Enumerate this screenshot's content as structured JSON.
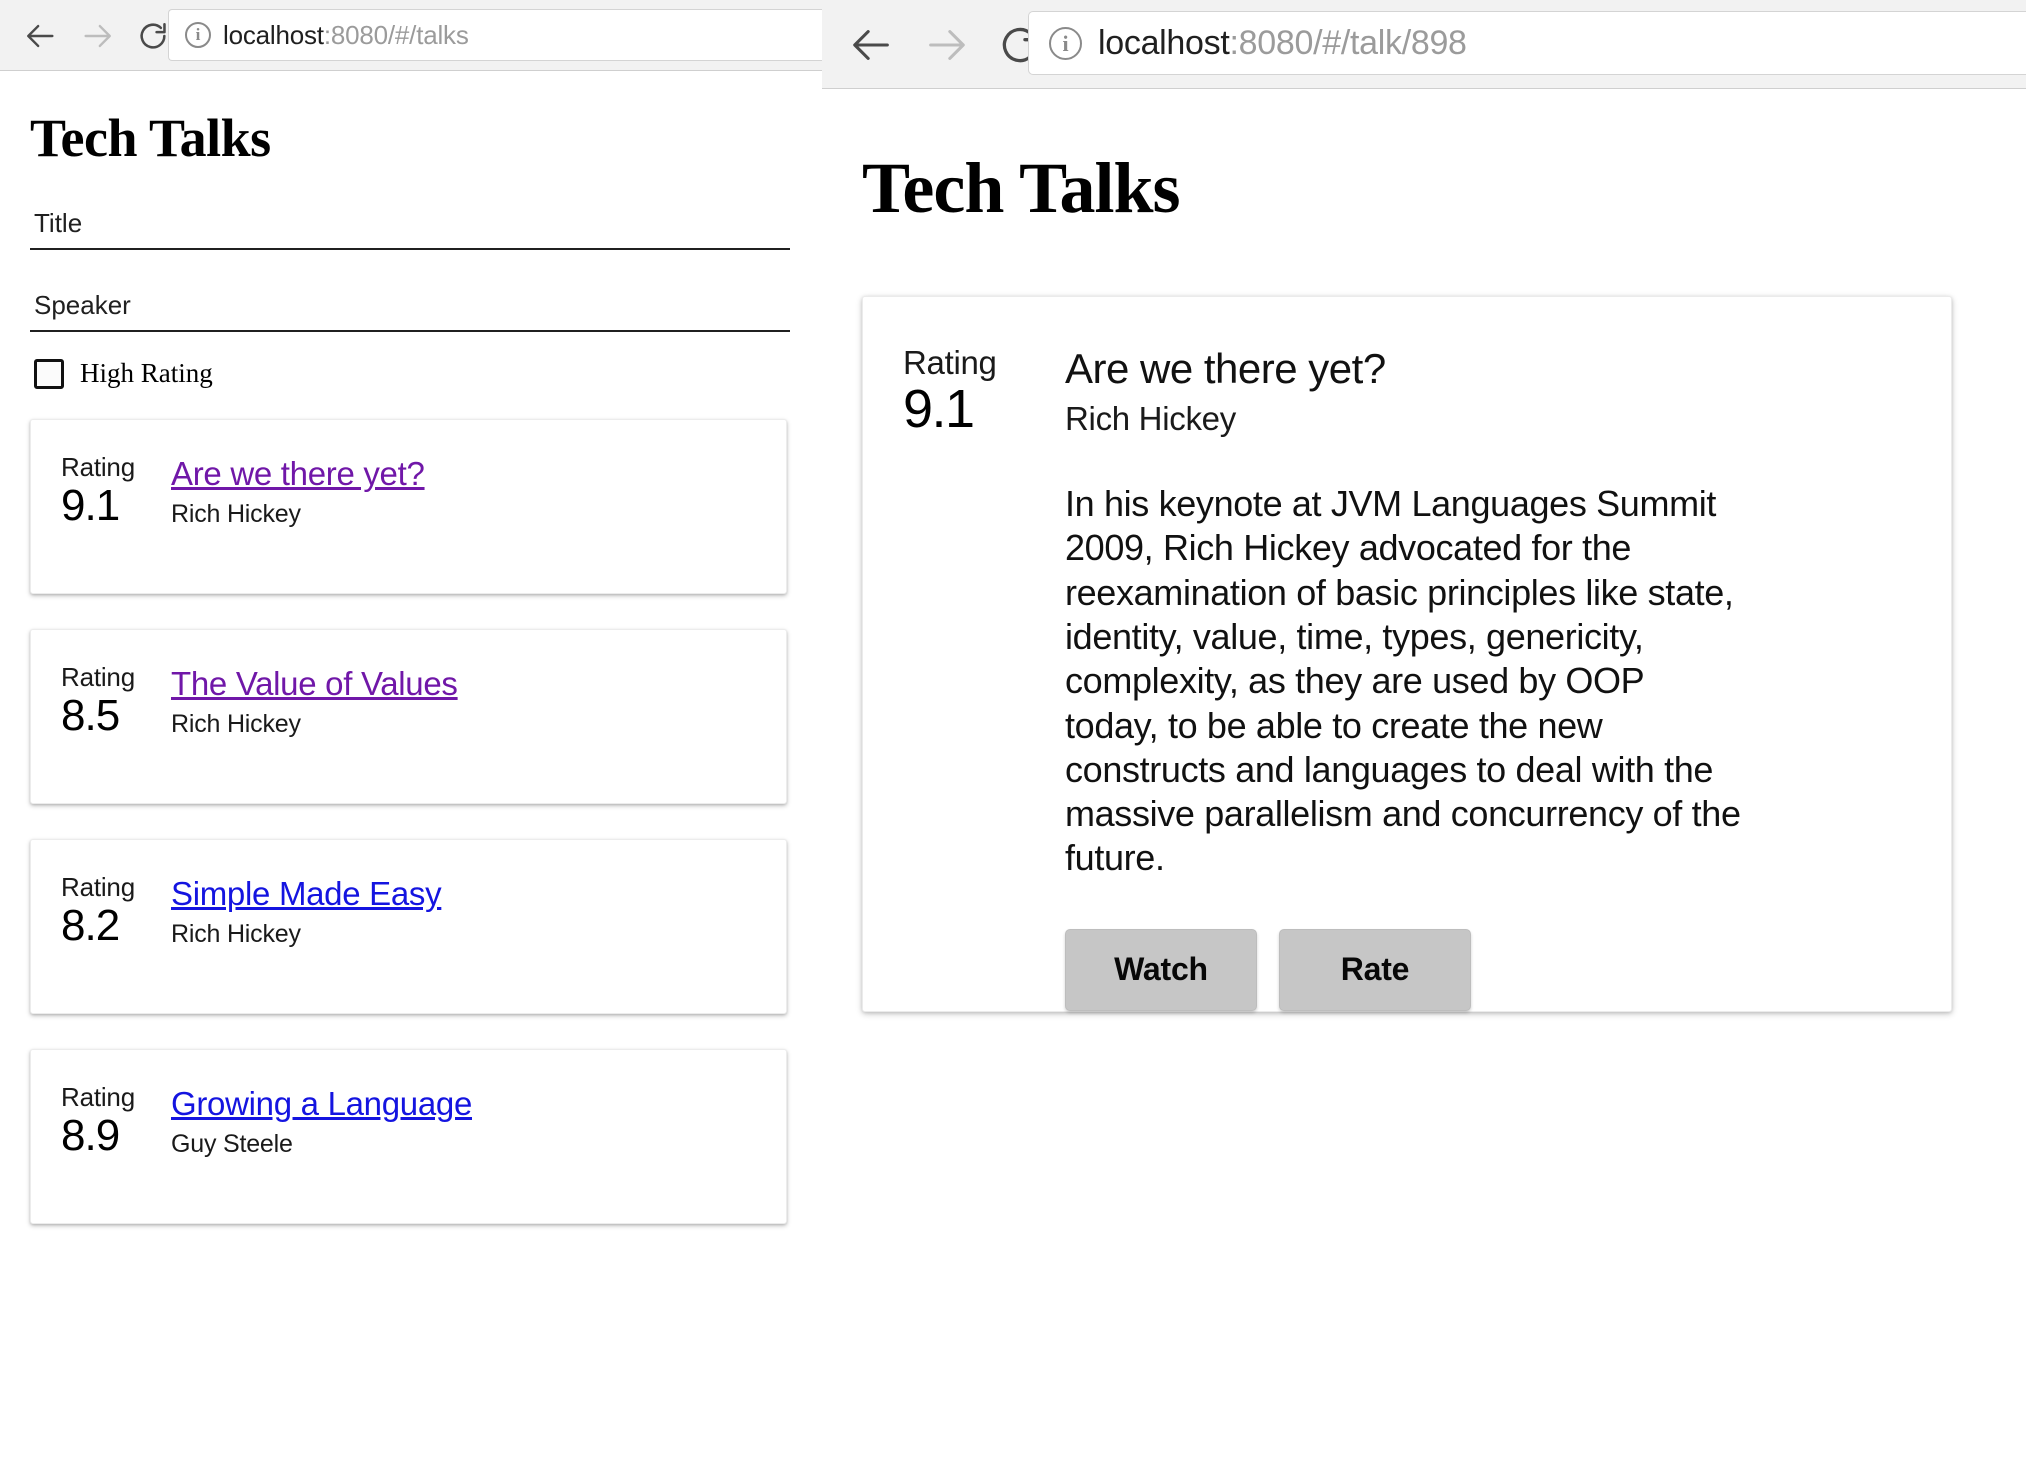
{
  "left_window": {
    "browser": {
      "back_icon": "back-arrow-icon",
      "forward_icon": "forward-arrow-icon",
      "reload_icon": "reload-icon",
      "site_info_icon": "info-circle-icon",
      "url_host": "localhost",
      "url_path": ":8080/#/talks",
      "url_full": "localhost:8080/#/talks"
    },
    "app_title": "Tech Talks",
    "filters": {
      "title_placeholder": "Title",
      "title_value": "",
      "speaker_placeholder": "Speaker",
      "speaker_value": "",
      "high_rating_label": "High Rating",
      "high_rating_checked": false
    },
    "rating_label": "Rating",
    "talks": [
      {
        "rating_label": "Rating",
        "rating": "9.1",
        "title": "Are we there yet?",
        "speaker": "Rich Hickey",
        "link_state": "visited"
      },
      {
        "rating_label": "Rating",
        "rating": "8.5",
        "title": "The Value of Values",
        "speaker": "Rich Hickey",
        "link_state": "visited"
      },
      {
        "rating_label": "Rating",
        "rating": "8.2",
        "title": "Simple Made Easy",
        "speaker": "Rich Hickey",
        "link_state": "unvisited"
      },
      {
        "rating_label": "Rating",
        "rating": "8.9",
        "title": "Growing a Language",
        "speaker": "Guy Steele",
        "link_state": "unvisited"
      }
    ]
  },
  "right_window": {
    "browser": {
      "back_icon": "back-arrow-icon",
      "forward_icon": "forward-arrow-icon",
      "reload_icon": "reload-icon",
      "site_info_icon": "info-circle-icon",
      "url_host": "localhost",
      "url_path": ":8080/#/talk/898",
      "url_full": "localhost:8080/#/talk/898"
    },
    "app_title": "Tech Talks",
    "detail": {
      "rating_label": "Rating",
      "rating": "9.1",
      "title": "Are we there yet?",
      "speaker": "Rich Hickey",
      "description": "In his keynote at JVM Languages Summit 2009, Rich Hickey advocated for the reexamination of basic principles like state, identity, value, time, types, genericity, complexity, as they are used by OOP today, to be able to create the new constructs and languages to deal with the massive parallelism and concurrency of the future.",
      "watch_label": "Watch",
      "rate_label": "Rate"
    }
  },
  "colors": {
    "visited_link": "#7017a8",
    "unvisited_link": "#1414e0",
    "button_bg": "#c6c6c6",
    "chrome_bg": "#f2f2f2",
    "text": "#111111"
  }
}
